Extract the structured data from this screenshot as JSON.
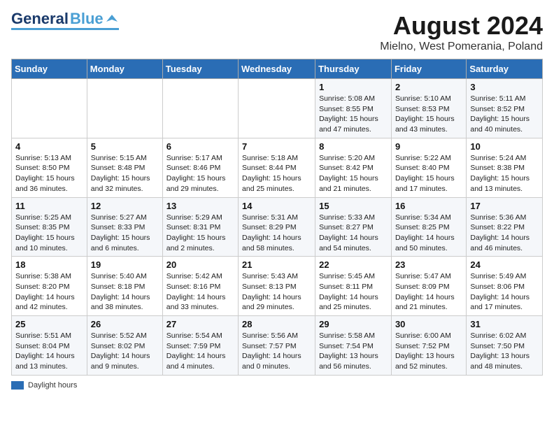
{
  "header": {
    "logo_general": "General",
    "logo_blue": "Blue",
    "month_title": "August 2024",
    "location": "Mielno, West Pomerania, Poland"
  },
  "days_of_week": [
    "Sunday",
    "Monday",
    "Tuesday",
    "Wednesday",
    "Thursday",
    "Friday",
    "Saturday"
  ],
  "weeks": [
    [
      {
        "day": "",
        "info": ""
      },
      {
        "day": "",
        "info": ""
      },
      {
        "day": "",
        "info": ""
      },
      {
        "day": "",
        "info": ""
      },
      {
        "day": "1",
        "info": "Sunrise: 5:08 AM\nSunset: 8:55 PM\nDaylight: 15 hours and 47 minutes."
      },
      {
        "day": "2",
        "info": "Sunrise: 5:10 AM\nSunset: 8:53 PM\nDaylight: 15 hours and 43 minutes."
      },
      {
        "day": "3",
        "info": "Sunrise: 5:11 AM\nSunset: 8:52 PM\nDaylight: 15 hours and 40 minutes."
      }
    ],
    [
      {
        "day": "4",
        "info": "Sunrise: 5:13 AM\nSunset: 8:50 PM\nDaylight: 15 hours and 36 minutes."
      },
      {
        "day": "5",
        "info": "Sunrise: 5:15 AM\nSunset: 8:48 PM\nDaylight: 15 hours and 32 minutes."
      },
      {
        "day": "6",
        "info": "Sunrise: 5:17 AM\nSunset: 8:46 PM\nDaylight: 15 hours and 29 minutes."
      },
      {
        "day": "7",
        "info": "Sunrise: 5:18 AM\nSunset: 8:44 PM\nDaylight: 15 hours and 25 minutes."
      },
      {
        "day": "8",
        "info": "Sunrise: 5:20 AM\nSunset: 8:42 PM\nDaylight: 15 hours and 21 minutes."
      },
      {
        "day": "9",
        "info": "Sunrise: 5:22 AM\nSunset: 8:40 PM\nDaylight: 15 hours and 17 minutes."
      },
      {
        "day": "10",
        "info": "Sunrise: 5:24 AM\nSunset: 8:38 PM\nDaylight: 15 hours and 13 minutes."
      }
    ],
    [
      {
        "day": "11",
        "info": "Sunrise: 5:25 AM\nSunset: 8:35 PM\nDaylight: 15 hours and 10 minutes."
      },
      {
        "day": "12",
        "info": "Sunrise: 5:27 AM\nSunset: 8:33 PM\nDaylight: 15 hours and 6 minutes."
      },
      {
        "day": "13",
        "info": "Sunrise: 5:29 AM\nSunset: 8:31 PM\nDaylight: 15 hours and 2 minutes."
      },
      {
        "day": "14",
        "info": "Sunrise: 5:31 AM\nSunset: 8:29 PM\nDaylight: 14 hours and 58 minutes."
      },
      {
        "day": "15",
        "info": "Sunrise: 5:33 AM\nSunset: 8:27 PM\nDaylight: 14 hours and 54 minutes."
      },
      {
        "day": "16",
        "info": "Sunrise: 5:34 AM\nSunset: 8:25 PM\nDaylight: 14 hours and 50 minutes."
      },
      {
        "day": "17",
        "info": "Sunrise: 5:36 AM\nSunset: 8:22 PM\nDaylight: 14 hours and 46 minutes."
      }
    ],
    [
      {
        "day": "18",
        "info": "Sunrise: 5:38 AM\nSunset: 8:20 PM\nDaylight: 14 hours and 42 minutes."
      },
      {
        "day": "19",
        "info": "Sunrise: 5:40 AM\nSunset: 8:18 PM\nDaylight: 14 hours and 38 minutes."
      },
      {
        "day": "20",
        "info": "Sunrise: 5:42 AM\nSunset: 8:16 PM\nDaylight: 14 hours and 33 minutes."
      },
      {
        "day": "21",
        "info": "Sunrise: 5:43 AM\nSunset: 8:13 PM\nDaylight: 14 hours and 29 minutes."
      },
      {
        "day": "22",
        "info": "Sunrise: 5:45 AM\nSunset: 8:11 PM\nDaylight: 14 hours and 25 minutes."
      },
      {
        "day": "23",
        "info": "Sunrise: 5:47 AM\nSunset: 8:09 PM\nDaylight: 14 hours and 21 minutes."
      },
      {
        "day": "24",
        "info": "Sunrise: 5:49 AM\nSunset: 8:06 PM\nDaylight: 14 hours and 17 minutes."
      }
    ],
    [
      {
        "day": "25",
        "info": "Sunrise: 5:51 AM\nSunset: 8:04 PM\nDaylight: 14 hours and 13 minutes."
      },
      {
        "day": "26",
        "info": "Sunrise: 5:52 AM\nSunset: 8:02 PM\nDaylight: 14 hours and 9 minutes."
      },
      {
        "day": "27",
        "info": "Sunrise: 5:54 AM\nSunset: 7:59 PM\nDaylight: 14 hours and 4 minutes."
      },
      {
        "day": "28",
        "info": "Sunrise: 5:56 AM\nSunset: 7:57 PM\nDaylight: 14 hours and 0 minutes."
      },
      {
        "day": "29",
        "info": "Sunrise: 5:58 AM\nSunset: 7:54 PM\nDaylight: 13 hours and 56 minutes."
      },
      {
        "day": "30",
        "info": "Sunrise: 6:00 AM\nSunset: 7:52 PM\nDaylight: 13 hours and 52 minutes."
      },
      {
        "day": "31",
        "info": "Sunrise: 6:02 AM\nSunset: 7:50 PM\nDaylight: 13 hours and 48 minutes."
      }
    ]
  ],
  "footer": {
    "legend_label": "Daylight hours"
  }
}
